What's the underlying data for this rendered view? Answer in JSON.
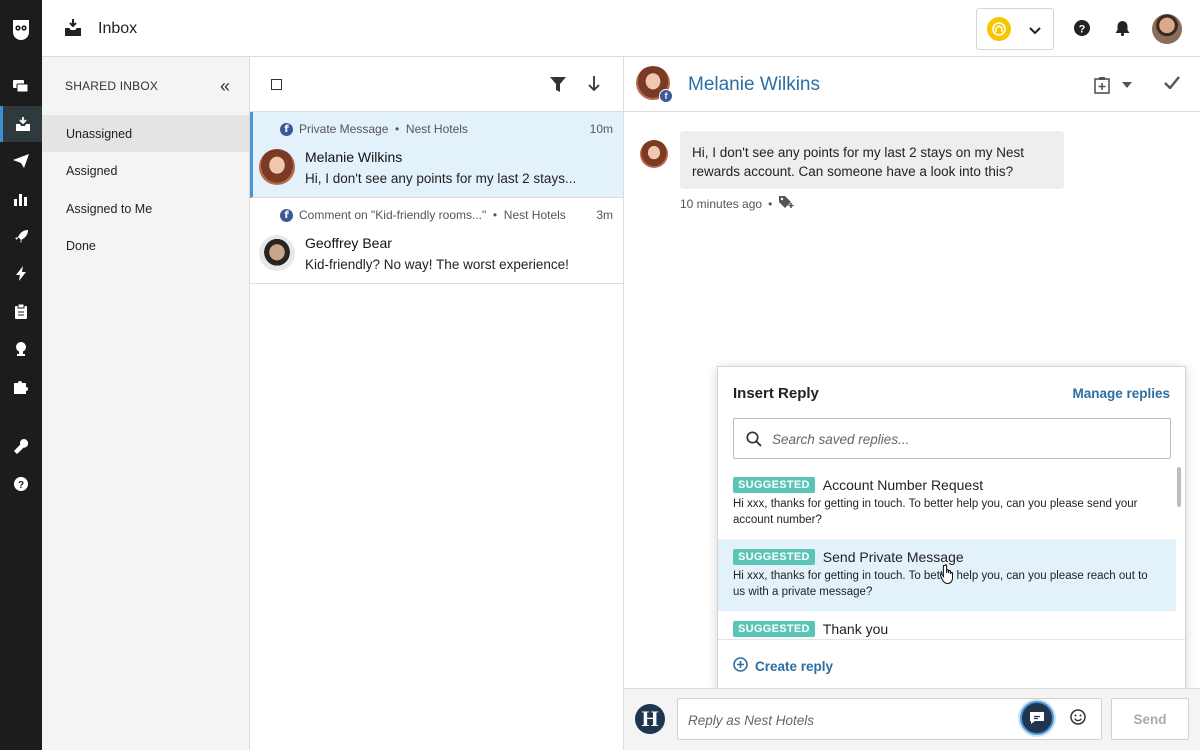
{
  "topbar": {
    "title": "Inbox"
  },
  "sidebar": {
    "title": "SHARED INBOX",
    "collapse_glyph": "«",
    "items": [
      {
        "label": "Unassigned",
        "active": true
      },
      {
        "label": "Assigned"
      },
      {
        "label": "Assigned to Me"
      },
      {
        "label": "Done"
      }
    ]
  },
  "conversations": [
    {
      "meta": "Private Message  •  Nest Hotels",
      "time": "10m",
      "name": "Melanie Wilkins",
      "snippet": "Hi, I don't see any points for my last 2 stays...",
      "selected": true
    },
    {
      "meta": "Comment on \"Kid-friendly rooms...\"  •  Nest Hotels",
      "time": "3m",
      "name": "Geoffrey Bear",
      "snippet": "Kid-friendly? No way! The worst experience!"
    }
  ],
  "pane": {
    "contact_name": "Melanie Wilkins",
    "message": {
      "text": "Hi, I don't see any points for my last 2 stays on my Nest rewards account. Can someone have a look into this?",
      "time": "10 minutes ago"
    }
  },
  "insert_reply": {
    "title": "Insert Reply",
    "manage_label": "Manage replies",
    "search_placeholder": "Search saved replies...",
    "badge_label": "SUGGESTED",
    "replies": [
      {
        "title": "Account Number Request",
        "body": "Hi xxx, thanks for getting in touch. To better help you, can you please send your account number?"
      },
      {
        "title": "Send Private Message",
        "body": "Hi xxx, thanks for getting in touch. To better help you, can you please reach out to us with a private message?",
        "highlighted": true
      },
      {
        "title": "Thank you",
        "body": ""
      }
    ],
    "create_label": "Create reply"
  },
  "composer": {
    "avatar_letter": "H",
    "placeholder": "Reply as Nest Hotels",
    "send_label": "Send"
  },
  "colors": {
    "accent": "#2c6ea3",
    "suggested_badge": "#5ac5b6",
    "selected_row": "#e3f1fa",
    "rail": "#1c1c1c",
    "facebook": "#3b5998"
  }
}
